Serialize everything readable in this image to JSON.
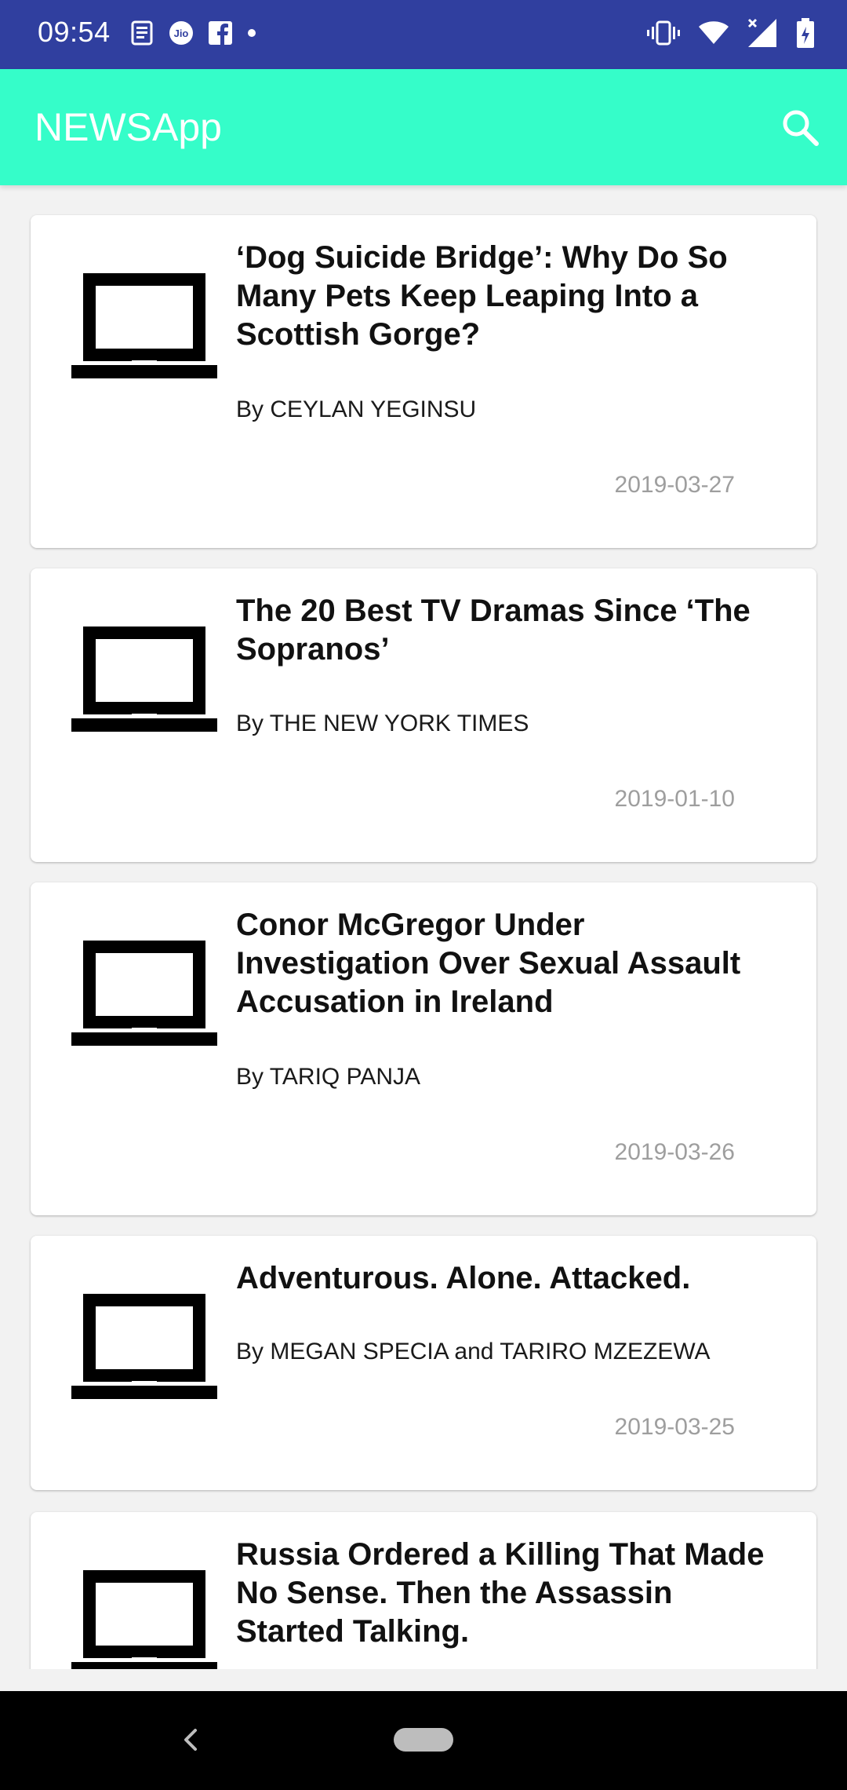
{
  "status_bar": {
    "time": "09:54",
    "icons_left": [
      "news-icon",
      "jio-icon",
      "facebook-icon",
      "notification-dot-icon"
    ],
    "icons_right": [
      "vibrate-icon",
      "wifi-icon",
      "signal-icon",
      "battery-icon"
    ],
    "jio_label": "Jio",
    "colors": {
      "background": "#303f9f",
      "text": "#ffffff"
    }
  },
  "app_bar": {
    "title": "NEWSApp",
    "search_icon": "search-icon",
    "colors": {
      "background": "#35fdc9",
      "title": "#ffffff"
    }
  },
  "articles": [
    {
      "title": "‘Dog Suicide Bridge’: Why Do So Many Pets Keep Leaping Into a Scottish Gorge?",
      "byline": "By CEYLAN YEGINSU",
      "date": "2019-03-27",
      "icon": "laptop-icon"
    },
    {
      "title": "The 20 Best TV Dramas Since ‘The Sopranos’",
      "byline": "By THE NEW YORK TIMES",
      "date": "2019-01-10",
      "icon": "laptop-icon"
    },
    {
      "title": "Conor McGregor Under Investigation Over Sexual Assault Accusation in Ireland",
      "byline": "By TARIQ PANJA",
      "date": "2019-03-26",
      "icon": "laptop-icon"
    },
    {
      "title": "Adventurous. Alone. Attacked.",
      "byline": "By MEGAN SPECIA and TARIRO MZEZEWA",
      "date": "2019-03-25",
      "icon": "laptop-icon"
    },
    {
      "title": "Russia Ordered a Killing That Made No Sense. Then the Assassin Started Talking.",
      "byline": "",
      "date": "",
      "icon": "laptop-icon"
    }
  ],
  "nav_bar": {
    "back_icon": "back-chevron-icon",
    "home_icon": "home-pill-icon"
  },
  "colors": {
    "background": "#f2f2f2",
    "card": "#ffffff",
    "title_text": "#111111",
    "date_text": "#9e9e9e"
  }
}
